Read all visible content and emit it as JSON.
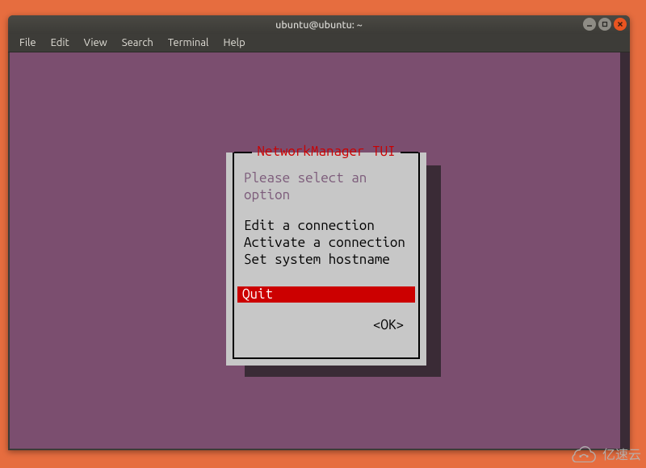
{
  "titlebar": {
    "title": "ubuntu@ubuntu: ~"
  },
  "menubar": {
    "items": [
      {
        "label": "File"
      },
      {
        "label": "Edit"
      },
      {
        "label": "View"
      },
      {
        "label": "Search"
      },
      {
        "label": "Terminal"
      },
      {
        "label": "Help"
      }
    ]
  },
  "tui": {
    "title": "NetworkManager TUI",
    "prompt": "Please select an option",
    "options": [
      {
        "label": "Edit a connection",
        "selected": false
      },
      {
        "label": "Activate a connection",
        "selected": false
      },
      {
        "label": "Set system hostname",
        "selected": false
      }
    ],
    "selected_option": {
      "label": "Quit"
    },
    "ok_label": "<OK>"
  },
  "watermark": {
    "text": "亿速云"
  }
}
